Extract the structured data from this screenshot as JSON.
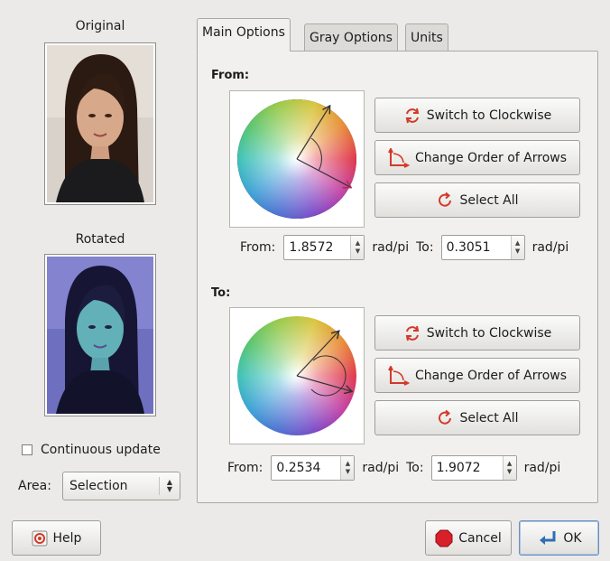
{
  "left": {
    "original_label": "Original",
    "rotated_label": "Rotated",
    "continuous_update_label": "Continuous update",
    "continuous_update_checked": false,
    "area_label": "Area:",
    "area_value": "Selection"
  },
  "tabs": [
    {
      "label": "Main Options",
      "active": true
    },
    {
      "label": "Gray Options",
      "active": false
    },
    {
      "label": "Units",
      "active": false
    }
  ],
  "from_section": {
    "title": "From:",
    "switch_label": "Switch to Clockwise",
    "order_label": "Change Order of Arrows",
    "select_all_label": "Select All",
    "from_label": "From:",
    "from_value": "1.8572",
    "to_label": "To:",
    "to_value": "0.3051",
    "unit": "rad/pi"
  },
  "to_section": {
    "title": "To:",
    "switch_label": "Switch to Clockwise",
    "order_label": "Change Order of Arrows",
    "select_all_label": "Select All",
    "from_label": "From:",
    "from_value": "0.2534",
    "to_label": "To:",
    "to_value": "1.9072",
    "unit": "rad/pi"
  },
  "footer": {
    "help_label": "Help",
    "cancel_label": "Cancel",
    "ok_label": "OK"
  },
  "icons": {
    "rotate": "rotate-icon",
    "arrows_order": "arrow-order-icon",
    "select_all": "select-all-icon",
    "help": "help-icon",
    "cancel": "cancel-icon",
    "ok": "ok-icon"
  },
  "colors": {
    "accent_red": "#d23a2a",
    "window_bg": "#ebeae8"
  }
}
